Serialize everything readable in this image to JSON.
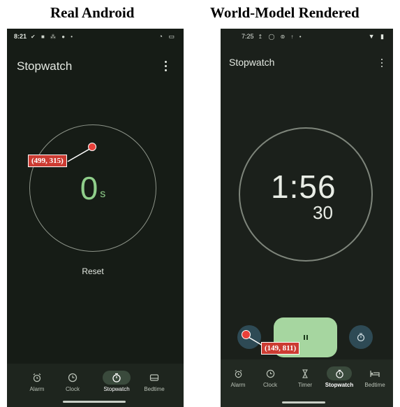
{
  "headings": {
    "left": "Real Android",
    "right": "World-Model Rendered"
  },
  "left_phone": {
    "status_time": "8:21",
    "status_icons": "✔ ■ ⁂ ● •",
    "status_right": "◔ ▭",
    "title": "Stopwatch",
    "display_value": "0",
    "display_unit": "s",
    "reset_label": "Reset",
    "annotation": "(499, 315)",
    "nav": [
      {
        "label": "Alarm",
        "icon": "alarm-icon"
      },
      {
        "label": "Clock",
        "icon": "clock-icon"
      },
      {
        "label": "Stopwatch",
        "icon": "stopwatch-icon",
        "active": true
      },
      {
        "label": "Bedtime",
        "icon": "bedtime-icon"
      }
    ]
  },
  "right_phone": {
    "status_time": "7:25",
    "status_icons": "↥ ◯ ⊚ ↑ •",
    "status_right": "▼ ▮",
    "title": "Stopwatch",
    "display_main": "1:56",
    "display_sub": "30",
    "annotation": "(149, 811)",
    "nav": [
      {
        "label": "Alarm",
        "icon": "alarm-icon"
      },
      {
        "label": "Clock",
        "icon": "clock-icon"
      },
      {
        "label": "Timer",
        "icon": "hourglass-icon"
      },
      {
        "label": "Stopwatch",
        "icon": "stopwatch-icon",
        "active": true
      },
      {
        "label": "Bedtime",
        "icon": "bed-icon"
      }
    ]
  },
  "colors": {
    "accent_green": "#8fce8a",
    "pause_button": "#a6d6a0",
    "lap_button": "#2e4a55",
    "annotation_red": "#cc3b32"
  }
}
